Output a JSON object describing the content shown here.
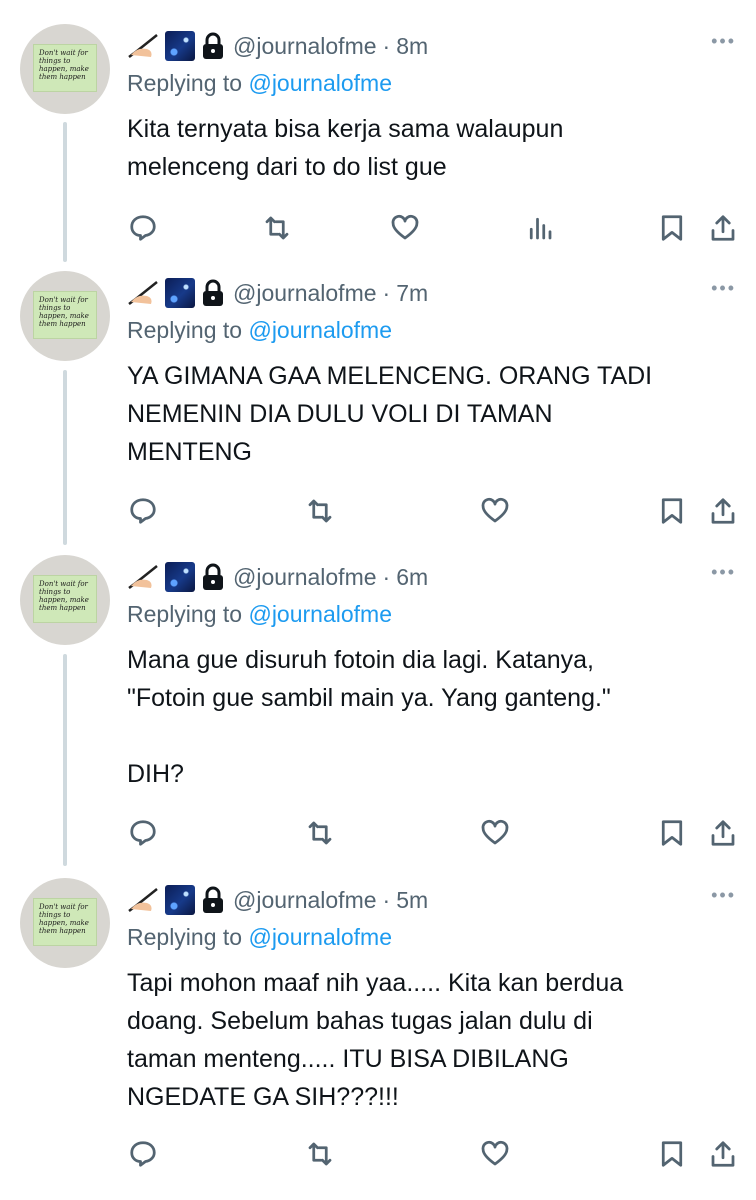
{
  "colors": {
    "text": "#0f1419",
    "muted": "#536471",
    "link": "#1d9bf0",
    "thread_line": "#cfd9de"
  },
  "avatar_note_text": "Don't wait for things to happen, make them happen",
  "tweets": [
    {
      "handle": "@journalofme",
      "separator": "·",
      "time": "8m",
      "reply_prefix": "Replying to",
      "reply_handle": "@journalofme",
      "text": "Kita ternyata bisa kerja sama walaupun\nmelenceng dari to do list gue",
      "show_views": true
    },
    {
      "handle": "@journalofme",
      "separator": "·",
      "time": "7m",
      "reply_prefix": "Replying to",
      "reply_handle": "@journalofme",
      "text": "YA GIMANA GAA MELENCENG. ORANG TADI\nNEMENIN DIA DULU VOLI DI TAMAN\nMENTENG",
      "show_views": false
    },
    {
      "handle": "@journalofme",
      "separator": "·",
      "time": "6m",
      "reply_prefix": "Replying to",
      "reply_handle": "@journalofme",
      "text": "Mana gue disuruh fotoin dia lagi. Katanya,\n\"Fotoin gue sambil main ya. Yang ganteng.\"\n\nDIH?",
      "show_views": false
    },
    {
      "handle": "@journalofme",
      "separator": "·",
      "time": "5m",
      "reply_prefix": "Replying to",
      "reply_handle": "@journalofme",
      "text": "Tapi mohon maaf nih yaa..... Kita kan berdua\ndoang. Sebelum bahas tugas jalan dulu di\ntaman menteng..... ITU BISA DIBILANG\nNGEDATE GA SIH???!!!",
      "show_views": false
    }
  ]
}
